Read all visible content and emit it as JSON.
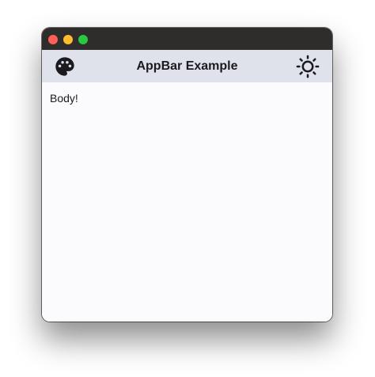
{
  "window": {
    "traffic_lights": [
      "close",
      "minimize",
      "zoom"
    ]
  },
  "appbar": {
    "title": "AppBar Example",
    "leading_icon": "palette-icon",
    "trailing_icon": "brightness-icon",
    "background": "#dfe2eb"
  },
  "body": {
    "text": "Body!"
  }
}
